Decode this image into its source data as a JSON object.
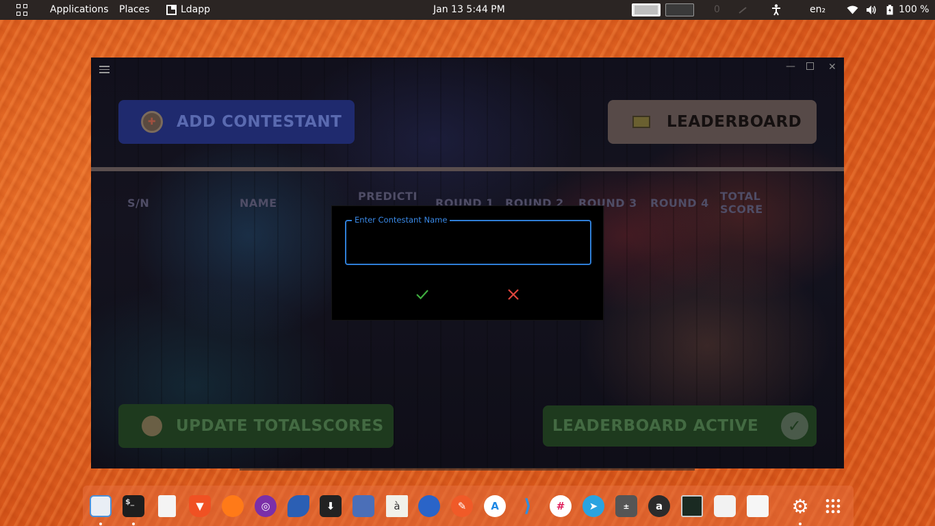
{
  "topbar": {
    "applications": "Applications",
    "places": "Places",
    "active_app": "Ldapp",
    "datetime": "Jan 13   5:44 PM",
    "counter": "0",
    "keyboard_layout": "en₂",
    "battery": "100 %"
  },
  "app": {
    "add_contestant": "ADD CONTESTANT",
    "leaderboard": "LEADERBOARD",
    "columns": {
      "sn": "S/N",
      "name": "NAME",
      "prediction": "PREDICTI",
      "round1": "ROUND 1",
      "round2": "ROUND 2",
      "round3": "ROUND 3",
      "round4": "ROUND 4",
      "total_score": "TOTAL\nSCORE"
    },
    "update_totalscores": "UPDATE TOTALSCORES",
    "leaderboard_active": "LEADERBOARD ACTIVE"
  },
  "dialog": {
    "field_label": "Enter Contestant Name",
    "field_value": ""
  },
  "dock": {
    "items": [
      "files",
      "terminal",
      "text-editor",
      "brave",
      "firefox",
      "tor-browser",
      "marine-app",
      "downloader",
      "screen-recorder",
      "character-map",
      "browser-globe",
      "pen-app",
      "maps-app",
      "vscode",
      "slack",
      "telegram",
      "calculator",
      "amazon",
      "system-monitor",
      "color-picker",
      "games",
      "settings",
      "app-grid"
    ]
  }
}
